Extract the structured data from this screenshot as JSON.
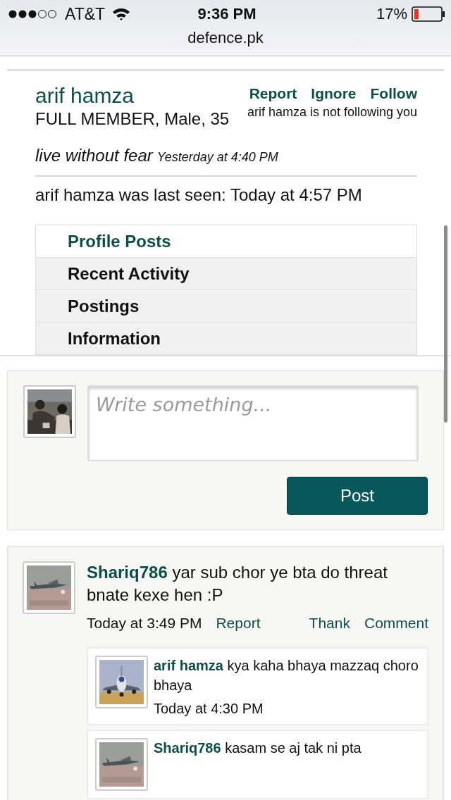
{
  "status_bar": {
    "carrier": "AT&T",
    "time": "9:36 PM",
    "battery": "17%"
  },
  "address_bar": {
    "url": "defence.pk"
  },
  "profile": {
    "name": "arif hamza",
    "details": "FULL MEMBER, Male, 35",
    "actions": [
      "Report",
      "Ignore",
      "Follow"
    ],
    "follow_note": "arif hamza is not following you",
    "status": {
      "text": "live without fear",
      "time": "Yesterday at 4:40 PM"
    },
    "last_seen": "arif hamza was last seen: Today at 4:57 PM",
    "tabs": [
      {
        "label": "Profile Posts",
        "selected": true
      },
      {
        "label": "Recent Activity",
        "selected": false
      },
      {
        "label": "Postings",
        "selected": false
      },
      {
        "label": "Information",
        "selected": false
      }
    ]
  },
  "post_form": {
    "placeholder": "Write something...",
    "button": "Post"
  },
  "posts": [
    {
      "author": "Shariq786",
      "text": "yar sub chor ye bta do threat bnate kexe hen :P",
      "time": "Today at 3:49 PM",
      "actions": [
        "Report",
        "Thank",
        "Comment"
      ],
      "comments": [
        {
          "author": "arif hamza",
          "text": "kya kaha bhaya mazzaq choro bhaya",
          "time": "Today at 4:30 PM"
        },
        {
          "author": "Shariq786",
          "text": "kasam se aj tak ni pta"
        }
      ]
    }
  ]
}
